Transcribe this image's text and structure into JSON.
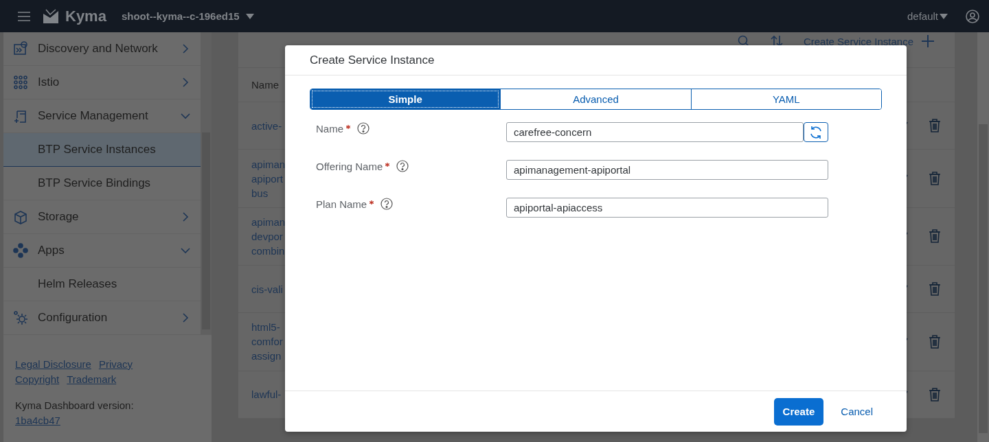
{
  "header": {
    "product": "Kyma",
    "cluster": "shoot--kyma--c-196ed15",
    "namespace": "default"
  },
  "sidebar": {
    "items": [
      {
        "label": "Discovery and Network",
        "kind": "network",
        "expanded": false,
        "selected": false
      },
      {
        "label": "Istio",
        "kind": "istio",
        "expanded": false,
        "selected": false
      },
      {
        "label": "Service Management",
        "kind": "service",
        "expanded": true,
        "selected": false,
        "children": [
          {
            "label": "BTP Service Instances",
            "selected": true
          },
          {
            "label": "BTP Service Bindings",
            "selected": false
          }
        ]
      },
      {
        "label": "Storage",
        "kind": "storage",
        "expanded": false,
        "selected": false
      },
      {
        "label": "Apps",
        "kind": "apps",
        "expanded": true,
        "selected": false,
        "children": [
          {
            "label": "Helm Releases",
            "selected": false
          }
        ]
      },
      {
        "label": "Configuration",
        "kind": "config",
        "expanded": false,
        "selected": false
      }
    ],
    "footer_links": [
      "Legal Disclosure",
      "Privacy",
      "Copyright",
      "Trademark"
    ],
    "version_label": "Kyma Dashboard version:",
    "version": "1ba4cb47"
  },
  "toolbar": {
    "create_label": "Create Service Instance"
  },
  "table": {
    "columns": [
      "Name"
    ],
    "rows": [
      {
        "name": [
          "active-"
        ]
      },
      {
        "name": [
          "apiman",
          "apiport",
          "bus"
        ]
      },
      {
        "name": [
          "apiman",
          "devpor",
          "combin"
        ]
      },
      {
        "name": [
          "cis-vali"
        ]
      },
      {
        "name": [
          "html5-",
          "comfor",
          "assign"
        ]
      },
      {
        "name": [
          "lawful-"
        ]
      }
    ]
  },
  "dialog": {
    "title": "Create Service Instance",
    "tabs": [
      {
        "label": "Simple",
        "selected": true
      },
      {
        "label": "Advanced",
        "selected": false
      },
      {
        "label": "YAML",
        "selected": false
      }
    ],
    "fields": [
      {
        "label": "Name",
        "required": true,
        "value": "carefree-concern",
        "regenerate": true
      },
      {
        "label": "Offering Name",
        "required": true,
        "value": "apimanagement-apiportal",
        "regenerate": false
      },
      {
        "label": "Plan Name",
        "required": true,
        "value": "apiportal-apiaccess",
        "regenerate": false
      }
    ],
    "primary_button": "Create",
    "secondary_button": "Cancel"
  }
}
